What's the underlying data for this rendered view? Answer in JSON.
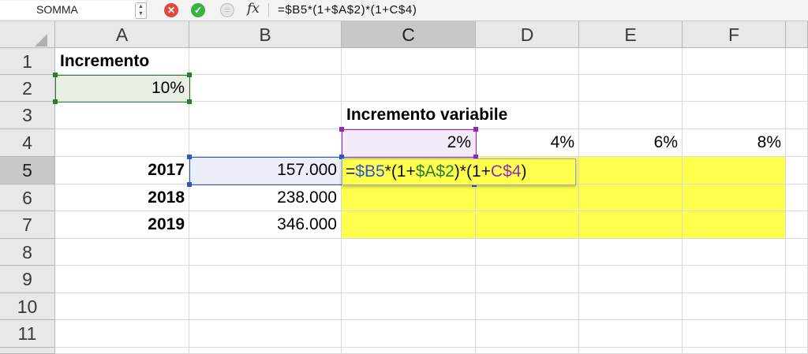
{
  "formula_bar": {
    "name_box": "SOMMA",
    "fx_label": "fx",
    "formula": "=$B5*(1+$A$2)*(1+C$4)"
  },
  "columns": [
    "A",
    "B",
    "C",
    "D",
    "E",
    "F"
  ],
  "rows": [
    "1",
    "2",
    "3",
    "4",
    "5",
    "6",
    "7",
    "8",
    "9",
    "10",
    "11"
  ],
  "active_cell": "C5",
  "cells": {
    "A1": "Incremento",
    "A2": "10%",
    "C3": "Incremento variabile",
    "C4": "2%",
    "D4": "4%",
    "E4": "6%",
    "F4": "8%",
    "A5": "2017",
    "B5": "157.000",
    "A6": "2018",
    "B6": "238.000",
    "A7": "2019",
    "B7": "346.000"
  },
  "edit_formula": {
    "eq": "=",
    "ref1": "$B5",
    "op1": "*(1+",
    "ref2": "$A$2",
    "op2": ")*(1+",
    "ref3": "C$4",
    "op3": ")"
  },
  "colors": {
    "highlight": "#ffff4d",
    "ref_b": "#2b57c8",
    "ref_a": "#2e7a2e",
    "ref_c": "#8e2bb8"
  }
}
